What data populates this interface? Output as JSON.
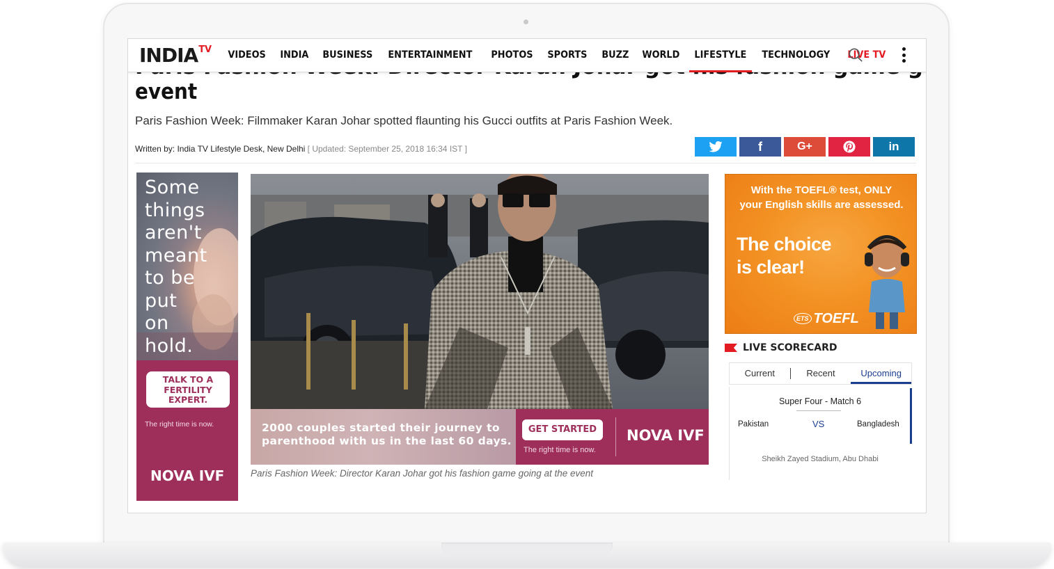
{
  "nav": {
    "logo_main": "INDIA",
    "logo_sup": "TV",
    "items": [
      "VIDEOS",
      "INDIA",
      "BUSINESS",
      "ENTERTAINMENT",
      "PHOTOS",
      "SPORTS",
      "BUZZ",
      "WORLD",
      "LIFESTYLE",
      "TECHNOLOGY",
      "LIVE TV"
    ],
    "active": "LIFESTYLE"
  },
  "article": {
    "title_cut": "Paris Fashion Week: Director Karan Johar got his fashion game going at the",
    "title_line2": "event",
    "summary": "Paris Fashion Week: Filmmaker Karan Johar spotted flaunting his Gucci outfits at Paris Fashion Week.",
    "byline": "Written by: India TV Lifestyle Desk, New Delhi",
    "updated": "[ Updated: September 25, 2018 16:34 IST ]",
    "caption": "Paris Fashion Week: Director Karan Johar got his fashion game going at the event"
  },
  "share": {
    "twitter": "twitter-icon",
    "facebook": "f",
    "googleplus": "G+",
    "pinterest": "pinterest-icon",
    "linkedin": "in"
  },
  "left_ad": {
    "headline_lines": [
      "Some",
      "things",
      "aren't",
      "meant",
      "to be",
      "put",
      "on",
      "hold."
    ],
    "cta_lines": [
      "TALK TO A",
      "FERTILITY",
      "EXPERT."
    ],
    "tagline": "The right time is now.",
    "logo": "NOVA IVF"
  },
  "bottom_banner": {
    "text": "2000 couples started their journey to parenthood with us in the last 60 days.",
    "button": "GET STARTED",
    "tagline": "The right time is now.",
    "logo": "NOVA IVF"
  },
  "toefl_ad": {
    "top_line1": "With the TOEFL® test, ONLY",
    "top_line2": "your English skills are assessed.",
    "choice_line1": "The choice",
    "choice_line2": "is clear!",
    "logo": "TOEFL",
    "ets": "ETS"
  },
  "scorecard": {
    "title": "LIVE SCORECARD",
    "tabs": [
      "Current",
      "Recent",
      "Upcoming"
    ],
    "active_tab": "Upcoming",
    "match": "Super Four - Match 6",
    "team_a": "Pakistan",
    "vs": "VS",
    "team_b": "Bangladesh",
    "venue": "Sheikh Zayed Stadium, Abu Dhabi"
  },
  "colors": {
    "brand_red": "#e31b23",
    "nova_magenta": "#9e2f5b",
    "toefl_orange": "#f39224",
    "score_blue": "#1a3d8f"
  }
}
